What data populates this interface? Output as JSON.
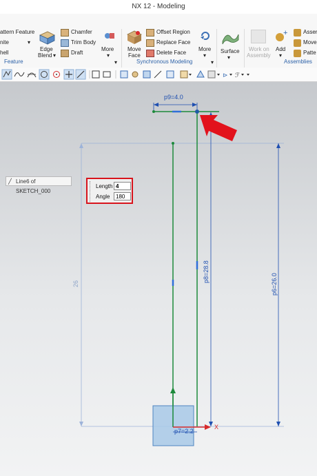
{
  "window": {
    "title": "NX 12 - Modeling"
  },
  "ribbon": {
    "pattern_feature": "attern Feature",
    "unite": "nite",
    "shell": "hell",
    "edge_blend": [
      "Edge",
      "Blend"
    ],
    "chamfer": "Chamfer",
    "trim_body": "Trim Body",
    "draft": "Draft",
    "more": "More",
    "move_face": [
      "Move",
      "Face"
    ],
    "offset_region": "Offset Region",
    "replace_face": "Replace Face",
    "delete_face": "Delete Face",
    "surface": "Surface",
    "work_on_assembly": [
      "Work on",
      "Assembly"
    ],
    "add": "Add",
    "assemblies_item": "Asser",
    "move_item": "Move",
    "pattern_item": "Patte",
    "groups": {
      "feature": "Feature",
      "synchronous_modeling": "Synchronous Modeling",
      "assemblies": "Assemblies"
    }
  },
  "sketch": {
    "tooltip": "Line6 of SKETCH_000",
    "length_label": "Length",
    "length_value": "4",
    "angle_label": "Angle",
    "angle_value": "180",
    "dim_p9": "p9=4.0",
    "dim_p8": "p8=28.8",
    "dim_p6": "p6=26.0",
    "dim_26": "26",
    "dim_p7": "p7=2.2",
    "axis_x": "X"
  },
  "colors": {
    "accent": "#2d62a8",
    "sketch_line": "#1d8a3b",
    "dimension": "#1f4fb0",
    "highlight": "#d8131c"
  }
}
